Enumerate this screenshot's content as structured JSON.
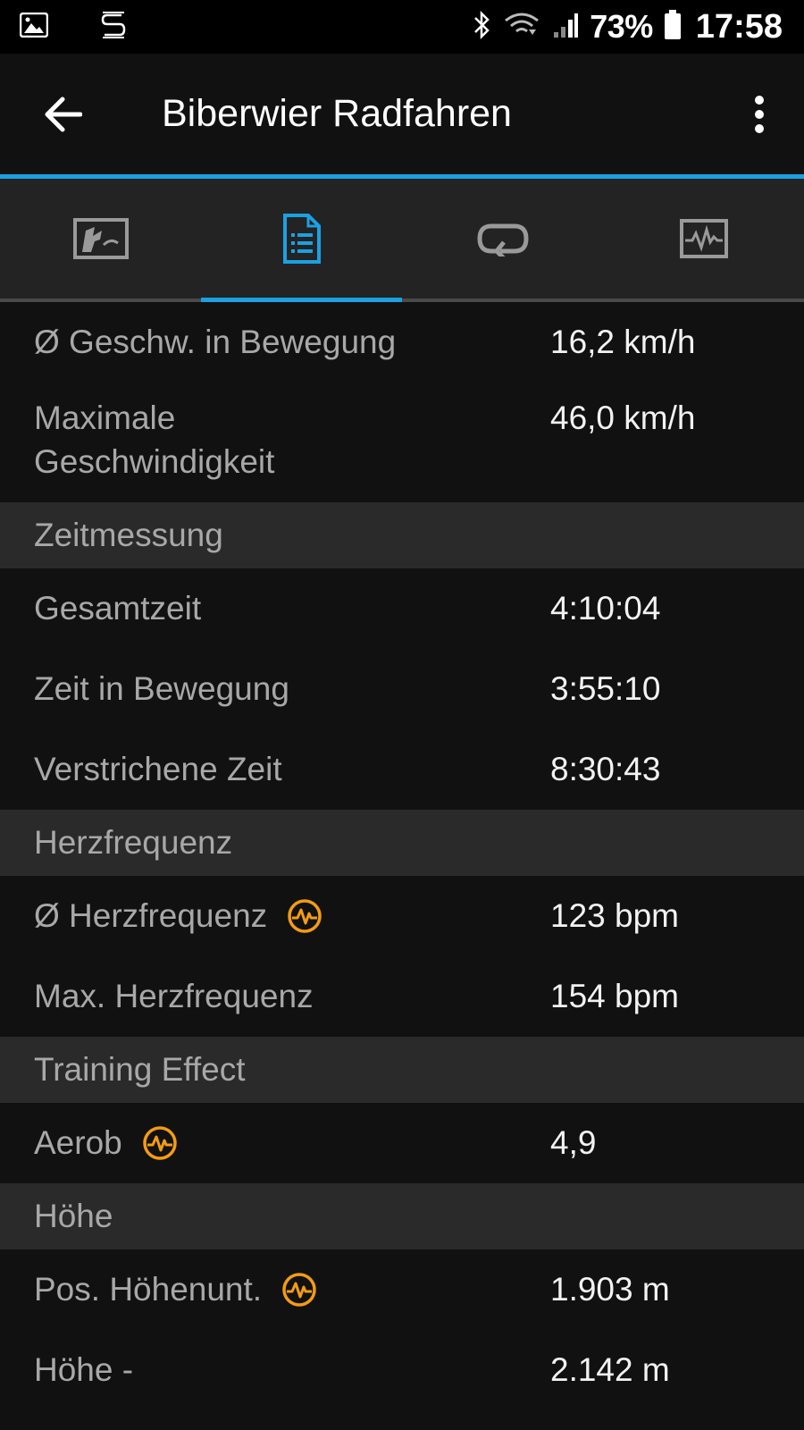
{
  "status_bar": {
    "battery": "73%",
    "time": "17:58"
  },
  "app_bar": {
    "title": "Biberwier Radfahren"
  },
  "tabs": [
    {
      "icon": "map-icon",
      "active": false
    },
    {
      "icon": "details-icon",
      "active": true
    },
    {
      "icon": "laps-icon",
      "active": false
    },
    {
      "icon": "chart-icon",
      "active": false
    }
  ],
  "stats": {
    "avg_moving_speed": {
      "label": "Ø Geschw. in Bewegung",
      "value": "16,2 km/h"
    },
    "max_speed": {
      "label_line1": "Maximale",
      "label_line2": "Geschwindigkeit",
      "value": "46,0 km/h"
    },
    "timing": {
      "header": "Zeitmessung",
      "total_time": {
        "label": "Gesamtzeit",
        "value": "4:10:04"
      },
      "moving_time": {
        "label": "Zeit in Bewegung",
        "value": "3:55:10"
      },
      "elapsed_time": {
        "label": "Verstrichene Zeit",
        "value": "8:30:43"
      }
    },
    "heart_rate": {
      "header": "Herzfrequenz",
      "avg": {
        "label": "Ø Herzfrequenz",
        "value": "123 bpm"
      },
      "max": {
        "label": "Max. Herzfrequenz",
        "value": "154 bpm"
      }
    },
    "training_effect": {
      "header": "Training Effect",
      "aerobic": {
        "label": "Aerob",
        "value": "4,9"
      }
    },
    "elevation": {
      "header": "Höhe",
      "gain": {
        "label": "Pos. Höhenunt.",
        "value": "1.903 m"
      },
      "loss": {
        "label": "Höhe -",
        "value": "2.142 m"
      }
    }
  },
  "colors": {
    "accent": "#1ba1e2",
    "hr_icon": "#f39c12",
    "background": "#111111",
    "section_bg": "#2a2a2a"
  }
}
